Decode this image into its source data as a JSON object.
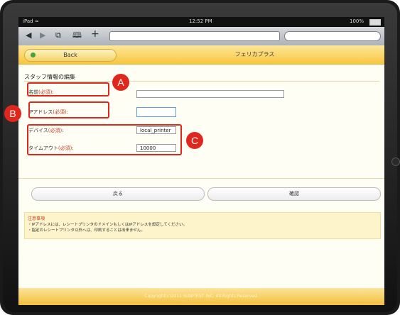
{
  "status_bar": {
    "device": "iPad ≈",
    "time": "12:52 PM",
    "battery": "100%"
  },
  "browser": {
    "icons": [
      "back-icon",
      "forward-icon",
      "pages-icon",
      "bookmarks-icon",
      "add-icon"
    ],
    "back_glyph": "◀",
    "forward_glyph": "▶",
    "pages_glyph": "⧉",
    "bookmarks_glyph": "🕮",
    "add_glyph": "+"
  },
  "header": {
    "back_label": "Back",
    "title": "フェリカプラス"
  },
  "form": {
    "section_title": "スタッフ情報の編集",
    "name_label": "名前",
    "name_required": "(必須)",
    "name_colon": ":",
    "name_value": "",
    "ip_label": "IPアドレス",
    "ip_required": "(必須)",
    "ip_colon": ":",
    "ip_value": "",
    "device_label": "デバイス",
    "device_required": "(必須)",
    "device_colon": ":",
    "device_value": "local_printer",
    "timeout_label": "タイムアウト",
    "timeout_required": "(必須)",
    "timeout_colon": ":",
    "timeout_value": "10000"
  },
  "buttons": {
    "back": "戻る",
    "confirm": "確認"
  },
  "notes": {
    "title": "注意事項",
    "lines": [
      "・IPアドレスには、レシートプリンタのドメインもしくはIPアドレスを設定してください。",
      "・指定のレシートプリンタ以外へは、印刷することは出来ません。"
    ]
  },
  "footer": {
    "text": "Copyright(c)2011 SUNFIRST INC. All Rights Reserved."
  },
  "annotations": {
    "a": "A",
    "b": "B",
    "c": "C",
    "color": "#e0271d"
  },
  "colors": {
    "header_yellow": "#f7c640",
    "required_red": "#c63a22",
    "focus_blue": "#5aa3df"
  }
}
